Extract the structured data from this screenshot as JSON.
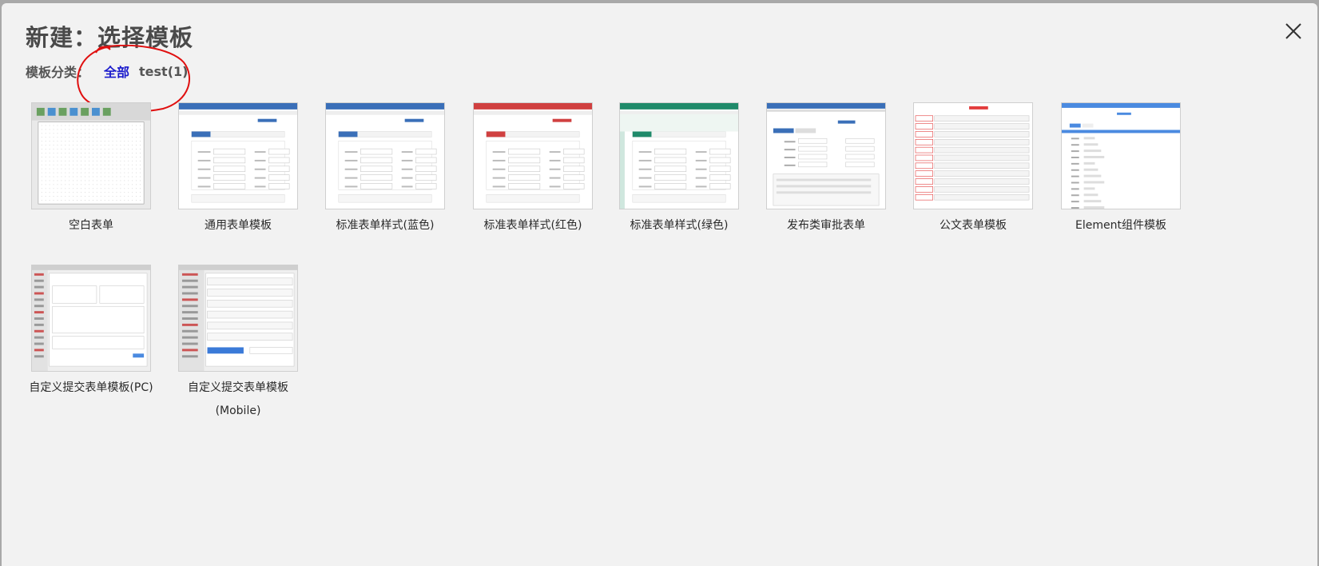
{
  "dialog": {
    "title": "新建：选择模板",
    "close_icon": "close-icon"
  },
  "categories": {
    "label": "模板分类：",
    "items": [
      {
        "label": "全部",
        "active": true
      },
      {
        "label": "test(1)",
        "active": false
      }
    ]
  },
  "annotation_color": "#e01010",
  "templates": [
    {
      "label": "空白表单",
      "thumb": "blank-designer",
      "accent": "#6c6c6c"
    },
    {
      "label": "通用表单模板",
      "thumb": "form-blue",
      "accent": "#3a6fb8"
    },
    {
      "label": "标准表单样式(蓝色)",
      "thumb": "form-blue",
      "accent": "#3a6fb8"
    },
    {
      "label": "标准表单样式(红色)",
      "thumb": "form-red",
      "accent": "#d04040"
    },
    {
      "label": "标准表单样式(绿色)",
      "thumb": "form-green",
      "accent": "#1f8a6a"
    },
    {
      "label": "发布类审批表单",
      "thumb": "publish-form",
      "accent": "#3a6fb8"
    },
    {
      "label": "公文表单模板",
      "thumb": "official-doc",
      "accent": "#e23c3c"
    },
    {
      "label": "Element组件模板",
      "thumb": "element-form",
      "accent": "#4a8ae0"
    },
    {
      "label": "自定义提交表单模板(PC)",
      "thumb": "custom-pc",
      "accent": "#4a8ae0"
    },
    {
      "label": "自定义提交表单模板\n(Mobile)",
      "thumb": "custom-mobile",
      "accent": "#3a7ad8"
    }
  ]
}
